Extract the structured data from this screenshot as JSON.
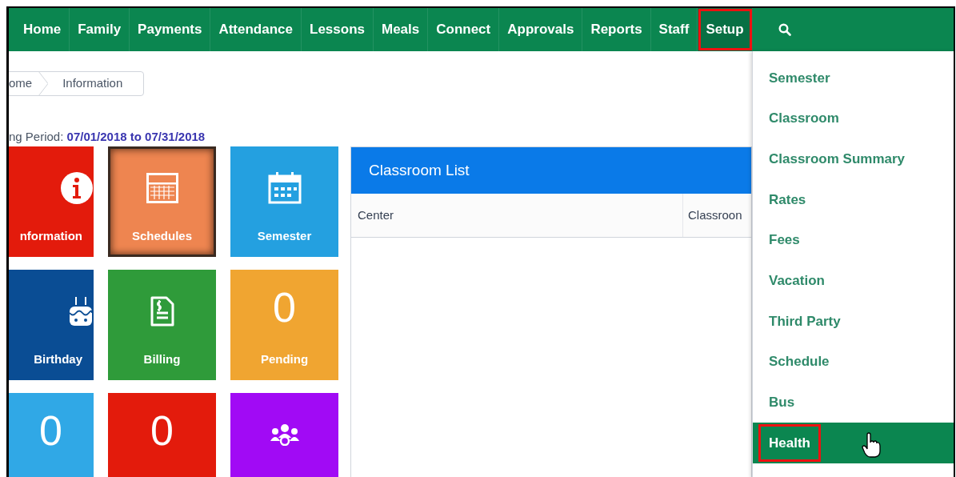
{
  "nav": {
    "items": [
      {
        "label": "Home",
        "selected": false,
        "annotated": false
      },
      {
        "label": "Family",
        "selected": false,
        "annotated": false
      },
      {
        "label": "Payments",
        "selected": false,
        "annotated": false
      },
      {
        "label": "Attendance",
        "selected": false,
        "annotated": false
      },
      {
        "label": "Lessons",
        "selected": false,
        "annotated": false
      },
      {
        "label": "Meals",
        "selected": false,
        "annotated": false
      },
      {
        "label": "Connect",
        "selected": false,
        "annotated": false
      },
      {
        "label": "Approvals",
        "selected": false,
        "annotated": false
      },
      {
        "label": "Reports",
        "selected": false,
        "annotated": false
      },
      {
        "label": "Staff",
        "selected": false,
        "annotated": false
      },
      {
        "label": "Setup",
        "selected": true,
        "annotated": true
      }
    ]
  },
  "breadcrumb": [
    "ome",
    "Information"
  ],
  "period": {
    "label": "ng Period:",
    "value": "07/01/2018 to 07/31/2018"
  },
  "tiles": [
    {
      "kind": "icon",
      "label": "nformation",
      "color": "#e31b0c",
      "selected": false
    },
    {
      "kind": "icon",
      "label": "Schedules",
      "color": "#ee8550",
      "selected": true
    },
    {
      "kind": "icon",
      "label": "Semester",
      "color": "#24a0e0",
      "selected": false
    },
    {
      "kind": "icon",
      "label": "Birthday",
      "color": "#0a4d94",
      "selected": false
    },
    {
      "kind": "icon",
      "label": "Billing",
      "color": "#2f9b3a",
      "selected": false
    },
    {
      "kind": "count",
      "count": "0",
      "label": "Pending",
      "color": "#f0a531",
      "selected": false
    },
    {
      "kind": "count",
      "count": "0",
      "color": "#30a8e6",
      "selected": false
    },
    {
      "kind": "count",
      "count": "0",
      "color": "#e31b0c",
      "selected": false
    },
    {
      "kind": "icon",
      "color": "#a10af5",
      "selected": false
    }
  ],
  "panel": {
    "title": "Classroom List",
    "columns": [
      "Center",
      "Classroon"
    ]
  },
  "setup_menu": {
    "items": [
      {
        "label": "Semester",
        "selected": false,
        "annotated": false
      },
      {
        "label": "Classroom",
        "selected": false,
        "annotated": false
      },
      {
        "label": "Classroom Summary",
        "selected": false,
        "annotated": false
      },
      {
        "label": "Rates",
        "selected": false,
        "annotated": false
      },
      {
        "label": "Fees",
        "selected": false,
        "annotated": false
      },
      {
        "label": "Vacation",
        "selected": false,
        "annotated": false
      },
      {
        "label": "Third Party",
        "selected": false,
        "annotated": false
      },
      {
        "label": "Schedule",
        "selected": false,
        "annotated": false
      },
      {
        "label": "Bus",
        "selected": false,
        "annotated": false
      },
      {
        "label": "Health",
        "selected": true,
        "annotated": true
      }
    ]
  }
}
